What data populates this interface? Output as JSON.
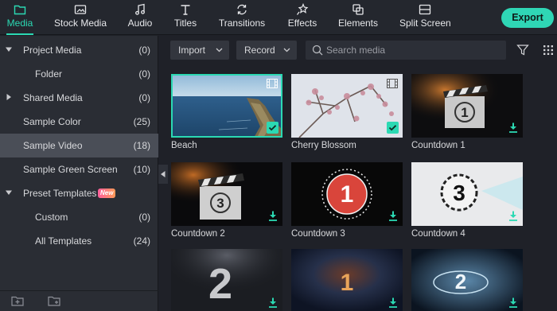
{
  "toolbar": {
    "tabs": [
      {
        "label": "Media",
        "icon": "folder-icon"
      },
      {
        "label": "Stock Media",
        "icon": "stock-media-icon"
      },
      {
        "label": "Audio",
        "icon": "music-note-icon"
      },
      {
        "label": "Titles",
        "icon": "text-t-icon"
      },
      {
        "label": "Transitions",
        "icon": "transitions-icon"
      },
      {
        "label": "Effects",
        "icon": "effects-sparkle-icon"
      },
      {
        "label": "Elements",
        "icon": "elements-icon"
      },
      {
        "label": "Split Screen",
        "icon": "split-screen-icon"
      }
    ],
    "active_tab": "Media",
    "export_label": "Export"
  },
  "sidebar": {
    "items": [
      {
        "label": "Project Media",
        "count": "(0)",
        "expandable": true,
        "expanded": true
      },
      {
        "label": "Folder",
        "count": "(0)"
      },
      {
        "label": "Shared Media",
        "count": "(0)",
        "expandable": true,
        "expanded": false
      },
      {
        "label": "Sample Color",
        "count": "(25)"
      },
      {
        "label": "Sample Video",
        "count": "(18)",
        "selected": true
      },
      {
        "label": "Sample Green Screen",
        "count": "(10)"
      },
      {
        "label": "Preset Templates",
        "badge": "New",
        "expandable": true,
        "expanded": true
      },
      {
        "label": "Custom",
        "count": "(0)"
      },
      {
        "label": "All Templates",
        "count": "(24)"
      }
    ]
  },
  "filters": {
    "import_label": "Import",
    "record_label": "Record",
    "search_placeholder": "Search media"
  },
  "media": [
    {
      "caption": "Beach",
      "selected": true,
      "added": true
    },
    {
      "caption": "Cherry Blossom",
      "added": true
    },
    {
      "caption": "Countdown 1",
      "download": true
    },
    {
      "caption": "Countdown 2",
      "download": true
    },
    {
      "caption": "Countdown 3",
      "download": true
    },
    {
      "caption": "Countdown 4",
      "download": true
    },
    {
      "caption": "",
      "download": true
    },
    {
      "caption": "",
      "download": true
    },
    {
      "caption": "",
      "download": true
    }
  ],
  "colors": {
    "accent": "#2bd9b3",
    "export": "#2fd6b5",
    "new_badge": "#ff5f9e"
  }
}
